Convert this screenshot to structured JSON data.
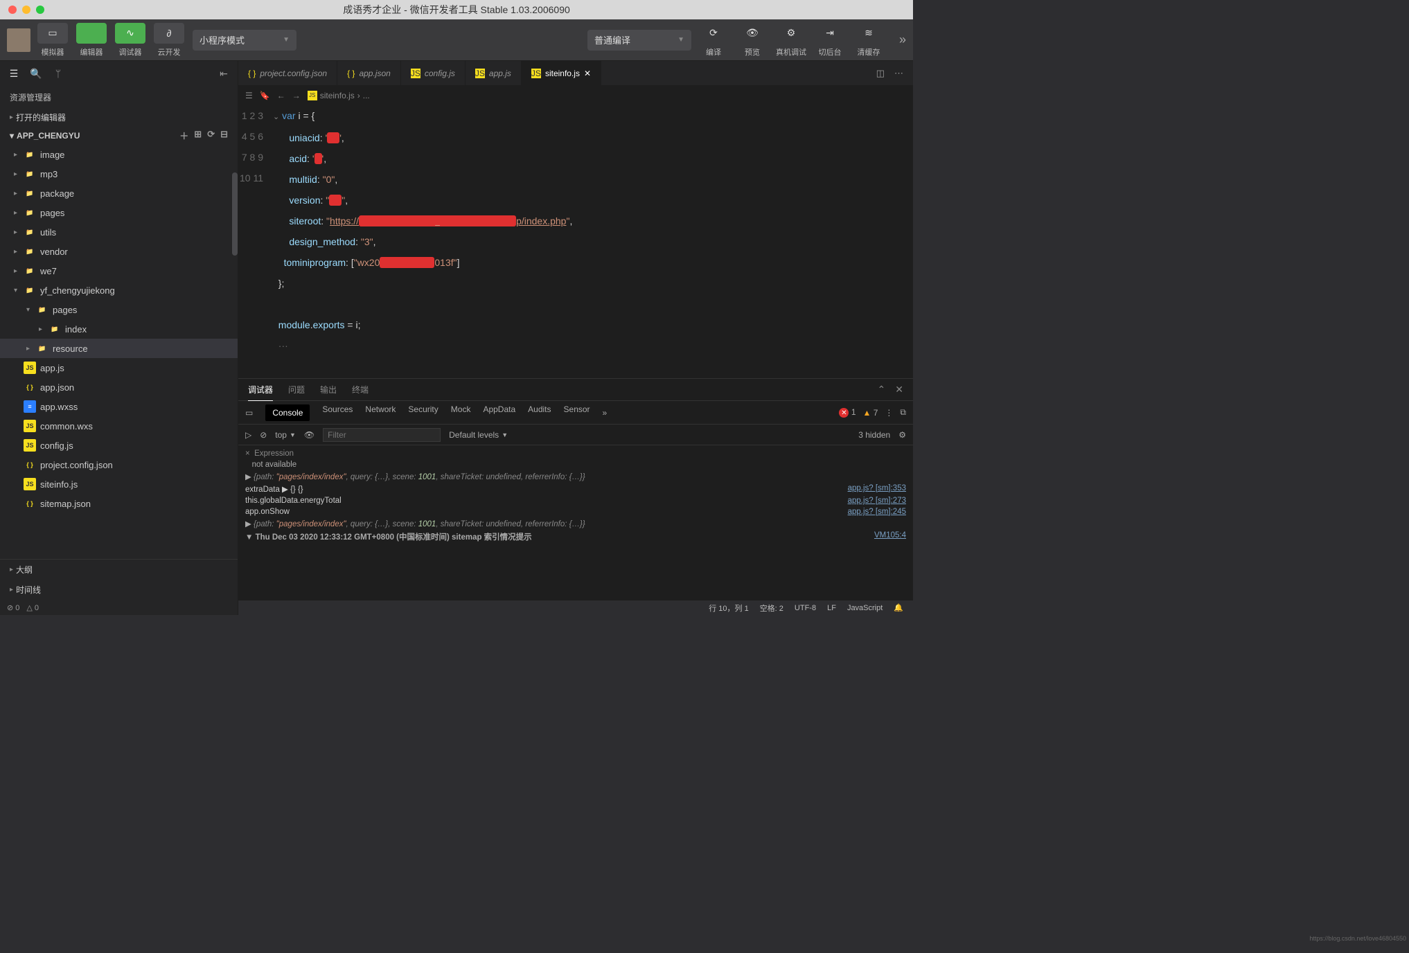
{
  "titlebar": {
    "title": "成语秀才企业 - 微信开发者工具 Stable 1.03.2006090"
  },
  "toolbar": {
    "buttons": [
      {
        "icon": "▭",
        "label": "模拟器"
      },
      {
        "icon": "</>",
        "label": "编辑器",
        "green": true
      },
      {
        "icon": "∿",
        "label": "调试器",
        "green": true
      },
      {
        "icon": "∂",
        "label": "云开发"
      }
    ],
    "mode": "小程序模式",
    "compile": "普通编译",
    "right": [
      {
        "icon": "⟳",
        "label": "编译"
      },
      {
        "icon": "👁",
        "label": "预览"
      },
      {
        "icon": "⚙",
        "label": "真机调试"
      },
      {
        "icon": "⇥",
        "label": "切后台"
      },
      {
        "icon": "≋",
        "label": "清缓存"
      }
    ]
  },
  "sidebar": {
    "title": "资源管理器",
    "open_editors": "打开的编辑器",
    "project": "APP_CHENGYU",
    "tree": [
      {
        "d": 1,
        "t": "folder",
        "c": "▸",
        "name": "image"
      },
      {
        "d": 1,
        "t": "folder",
        "c": "▸",
        "name": "mp3"
      },
      {
        "d": 1,
        "t": "folder",
        "c": "▸",
        "name": "package"
      },
      {
        "d": 1,
        "t": "folder",
        "c": "▸",
        "name": "pages"
      },
      {
        "d": 1,
        "t": "folder",
        "c": "▸",
        "name": "utils"
      },
      {
        "d": 1,
        "t": "folder",
        "c": "▸",
        "name": "vendor"
      },
      {
        "d": 1,
        "t": "folder",
        "c": "▸",
        "name": "we7"
      },
      {
        "d": 1,
        "t": "folder-open",
        "c": "▾",
        "name": "yf_chengyujiekong"
      },
      {
        "d": 2,
        "t": "folder-open",
        "c": "▾",
        "name": "pages",
        "color": "foldr"
      },
      {
        "d": 3,
        "t": "folder",
        "c": "▸",
        "name": "index"
      },
      {
        "d": 2,
        "t": "folder-res",
        "c": "▸",
        "name": "resource",
        "sel": true
      },
      {
        "d": 1,
        "t": "js",
        "name": "app.js"
      },
      {
        "d": 1,
        "t": "json",
        "name": "app.json"
      },
      {
        "d": 1,
        "t": "wxss",
        "name": "app.wxss"
      },
      {
        "d": 1,
        "t": "wxs",
        "name": "common.wxs"
      },
      {
        "d": 1,
        "t": "js",
        "name": "config.js"
      },
      {
        "d": 1,
        "t": "json",
        "name": "project.config.json"
      },
      {
        "d": 1,
        "t": "js",
        "name": "siteinfo.js"
      },
      {
        "d": 1,
        "t": "json",
        "name": "sitemap.json"
      }
    ],
    "outline": "大纲",
    "timeline": "时间线",
    "errs": "0",
    "warns": "0"
  },
  "tabs": [
    {
      "t": "json",
      "name": "project.config.json"
    },
    {
      "t": "json",
      "name": "app.json"
    },
    {
      "t": "js",
      "name": "config.js"
    },
    {
      "t": "js",
      "name": "app.js"
    },
    {
      "t": "js",
      "name": "siteinfo.js",
      "active": true
    }
  ],
  "crumbs": {
    "file": "siteinfo.js",
    "rest": "..."
  },
  "code": {
    "lines": [
      {
        "n": 1,
        "html": "<span class='k'>var</span> i = {"
      },
      {
        "n": 2,
        "html": "    <span class='p'>uniacid</span>: <span class='s'>'<span class='red'>xx</span>'</span>,"
      },
      {
        "n": 3,
        "html": "    <span class='p'>acid</span>: <span class='s'>'<span class='red'>x</span>'</span>,"
      },
      {
        "n": 4,
        "html": "    <span class='p'>multiid</span>: <span class='s'>\"0\"</span>,"
      },
      {
        "n": 5,
        "html": "    <span class='p'>version</span>: <span class='s'>\"<span class='red'>xx</span>\"</span>,"
      },
      {
        "n": 6,
        "html": "    <span class='p'>siteroot</span>: <span class='s'>\"<span class='lnk'>https://<span class='red' style='padding:0 110px'>x</span>p/index.php</span>\"</span>,"
      },
      {
        "n": 7,
        "html": "    <span class='p'>design_method</span>: <span class='s'>\"3\"</span>,"
      },
      {
        "n": 8,
        "html": "  <span class='p'>tominiprogram</span>: [<span class='s'>\"wx20<span class='red' style='padding:0 36px'>x</span>013f\"</span>]"
      },
      {
        "n": 9,
        "html": "};"
      },
      {
        "n": 10,
        "html": ""
      },
      {
        "n": 11,
        "html": "<span class='p'>module</span>.<span class='p'>exports</span> = i;"
      }
    ]
  },
  "panel": {
    "tabs": [
      "调试器",
      "问题",
      "输出",
      "终端"
    ],
    "devtabs": [
      "Console",
      "Sources",
      "Network",
      "Security",
      "Mock",
      "AppData",
      "Audits",
      "Sensor"
    ],
    "err": "1",
    "warn": "7",
    "context": "top",
    "levels": "Default levels",
    "filterPlaceholder": "Filter",
    "hidden": "3 hidden",
    "expr_label": "Expression",
    "expr_na": "not available",
    "rows": [
      {
        "html": "▶ <span class='cit'>{path: <span class='cs'>\"pages/index/index\"</span>, query: {…}, scene: <span class='cn'>1001</span>, shareTicket: <span class='cu'>undefined</span>, referrerInfo: {…}}</span>"
      },
      {
        "html": "<span class='cz'>extraData ▶ {} {}</span>",
        "src": "app.js? [sm]:353"
      },
      {
        "html": "<span class='cz'>this.globalData.energyTotal</span>",
        "src": "app.js? [sm]:273"
      },
      {
        "html": "<span class='cz'>app.onShow</span>",
        "src": "app.js? [sm]:245"
      },
      {
        "html": "▶ <span class='cit'>{path: <span class='cs'>\"pages/index/index\"</span>, query: {…}, scene: <span class='cn'>1001</span>, shareTicket: <span class='cu'>undefined</span>, referrerInfo: {…}}</span>"
      },
      {
        "html": "▼ <b>Thu Dec 03 2020 12:33:12 GMT+0800 (中国标准时间) sitemap 索引情况提示</b>",
        "src": "VM105:4"
      }
    ]
  },
  "status": {
    "pos": "行 10，列 1",
    "spaces": "空格: 2",
    "enc": "UTF-8",
    "eol": "LF",
    "lang": "JavaScript"
  },
  "watermark": "https://blog.csdn.net/love46804550"
}
